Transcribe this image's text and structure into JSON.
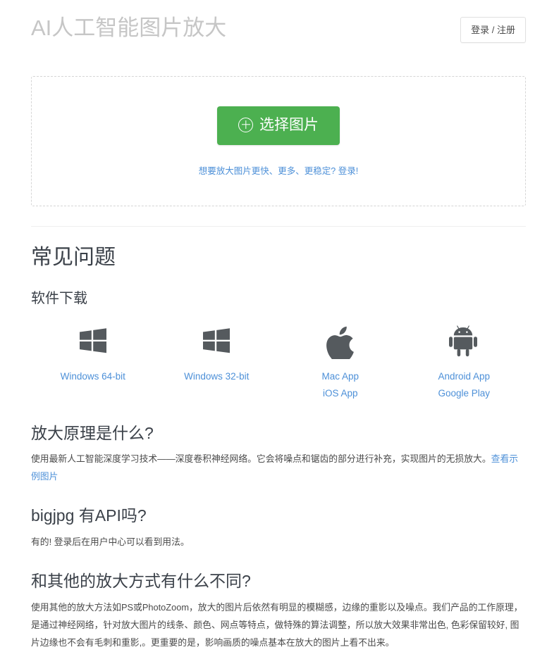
{
  "header": {
    "brand_title": "AI人工智能图片放大",
    "login_label": "登录 / 注册"
  },
  "upload": {
    "select_button_label": "选择图片",
    "select_button_icon": "plus-circle-icon",
    "hint_text": "想要放大图片更快、更多、更稳定? 登录!"
  },
  "faq": {
    "title": "常见问题",
    "download_subtitle": "软件下载",
    "downloads": [
      {
        "icon": "windows-icon",
        "links": [
          "Windows 64-bit"
        ]
      },
      {
        "icon": "windows-icon",
        "links": [
          "Windows 32-bit"
        ]
      },
      {
        "icon": "apple-icon",
        "links": [
          "Mac App",
          "iOS App"
        ]
      },
      {
        "icon": "android-icon",
        "links": [
          "Android App",
          "Google Play"
        ]
      }
    ],
    "items": [
      {
        "question": "放大原理是什么?",
        "answer": "使用最新人工智能深度学习技术——深度卷积神经网络。它会将噪点和锯齿的部分进行补充，实现图片的无损放大。",
        "answer_link": "查看示例图片"
      },
      {
        "question": "bigjpg 有API吗?",
        "answer": "有的! 登录后在用户中心可以看到用法。",
        "answer_link": ""
      },
      {
        "question": "和其他的放大方式有什么不同?",
        "answer": "使用其他的放大方法如PS或PhotoZoom，放大的图片后依然有明显的模糊感，边缘的重影以及噪点。我们产品的工作原理，是通过神经网络，针对放大图片的线条、颜色、网点等特点，做特殊的算法调整，所以放大效果非常出色, 色彩保留较好, 图片边缘也不会有毛刺和重影,。更重要的是，影响画质的噪点基本在放大的图片上看不出来。",
        "answer_link": ""
      }
    ]
  },
  "colors": {
    "accent_green": "#4cb050",
    "link_blue": "#4d90d8",
    "title_gray": "#c6c6c6",
    "icon_gray": "#555a5e",
    "heading_dark": "#3b4149"
  }
}
